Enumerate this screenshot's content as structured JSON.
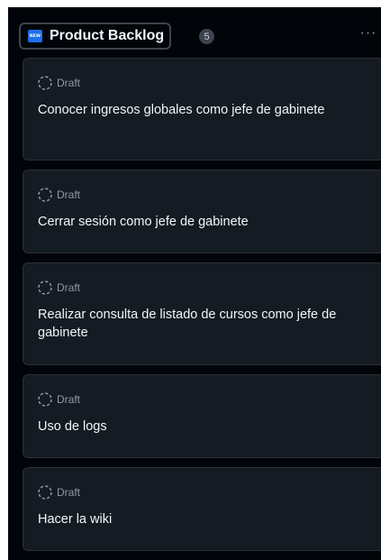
{
  "column": {
    "title": "Product Backlog",
    "count": "5",
    "icon": "new-icon",
    "icon_text": "NEW",
    "more_label": "···"
  },
  "cards": [
    {
      "status": "Draft",
      "title": "Conocer ingresos globales como jefe de gabinete"
    },
    {
      "status": "Draft",
      "title": "Cerrar sesión como jefe de gabinete"
    },
    {
      "status": "Draft",
      "title": "Realizar consulta de listado de cursos como jefe de gabinete"
    },
    {
      "status": "Draft",
      "title": "Uso de logs"
    },
    {
      "status": "Draft",
      "title": "Hacer la wiki"
    }
  ],
  "colors": {
    "background": "#010409",
    "card": "#151b23",
    "accent": "#1f6feb",
    "text": "#f0f6fc",
    "muted": "#9198a1"
  }
}
